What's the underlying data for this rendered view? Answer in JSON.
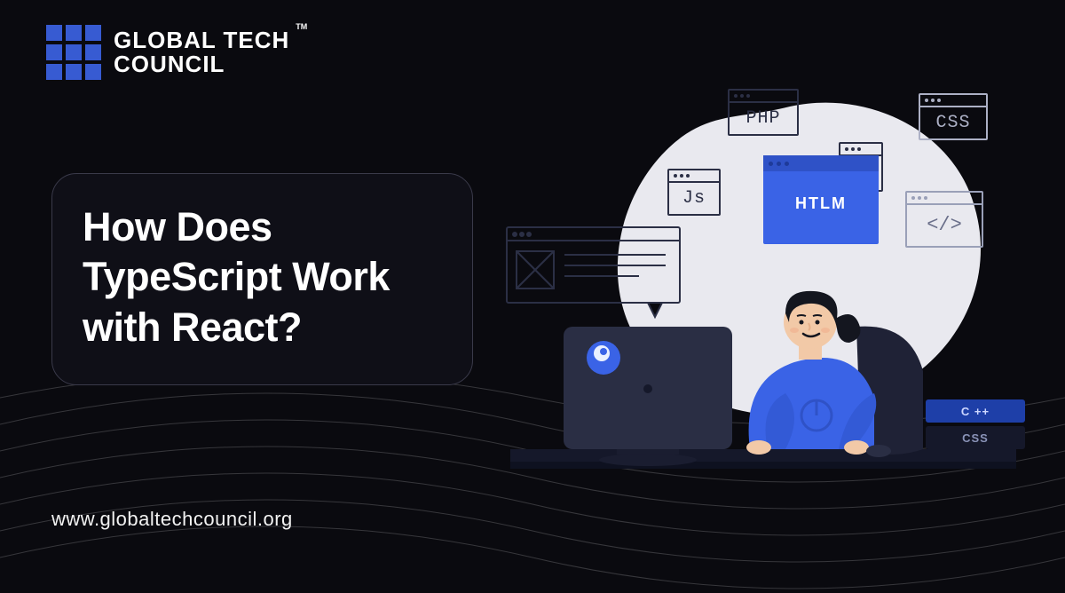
{
  "logo": {
    "line1": "GLOBAL TECH",
    "line2": "COUNCIL",
    "trademark": "TM"
  },
  "headline": "How Does TypeScript Work with React?",
  "website_url": "www.globaltechcouncil.org",
  "illustration": {
    "window_labels": {
      "php": "PHP",
      "css": "CSS",
      "js": "Js",
      "html": "HTLM",
      "code_symbol": "</>"
    },
    "books": {
      "top": "C ++",
      "bottom": "CSS"
    }
  },
  "colors": {
    "background": "#0a0a0f",
    "accent_blue": "#3a63e6",
    "logo_blue": "#375bd2"
  }
}
